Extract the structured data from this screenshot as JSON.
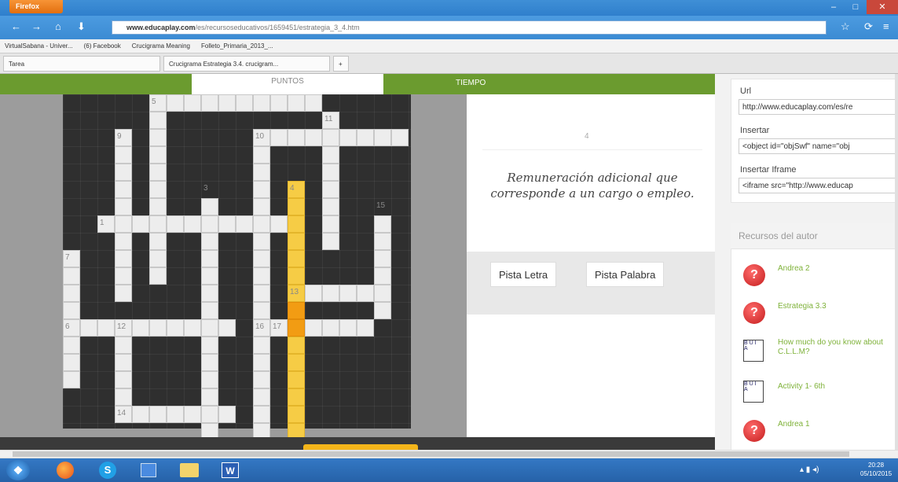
{
  "browser": {
    "app_button": "Firefox",
    "url_domain": "www.educaplay.com",
    "url_rest": "/es/recursoseducativos/1659451/estrategia_3_4.htm",
    "bookmarks": [
      "VirtualSabana - Univer...",
      "(6) Facebook",
      "Crucigrama Meaning",
      "Folleto_Primaria_2013_..."
    ],
    "tabs": [
      "Tarea",
      "Crucigrama Estrategia 3.4. crucigram...",
      "+"
    ]
  },
  "game": {
    "puntos_label": "PUNTOS",
    "tiempo_label": "TIEMPO",
    "clue_number": "4",
    "clue_text": "Remuneración adicional que corresponde a un cargo o empleo.",
    "hint_letter": "Pista Letra",
    "hint_word": "Pista Palabra",
    "numbers": [
      "5",
      "11",
      "9",
      "10",
      "3",
      "4",
      "15",
      "1",
      "7",
      "13",
      "6",
      "12",
      "16",
      "17",
      "14"
    ]
  },
  "sidebar": {
    "url_label": "Url",
    "url_value": "http://www.educaplay.com/es/re",
    "embed_label": "Insertar",
    "embed_value": "<object id=\"objSwf\" name=\"obj",
    "iframe_label": "Insertar Iframe",
    "iframe_value": "<iframe src=\"http://www.educap",
    "resources_title": "Recursos del autor",
    "resources": [
      {
        "title": "Andrea 2",
        "icon": "question-icon"
      },
      {
        "title": "Estrategia 3.3",
        "icon": "question-icon"
      },
      {
        "title": "How much do you know about C.L.L.M?",
        "icon": "text-format-icon"
      },
      {
        "title": "Activity 1- 6th",
        "icon": "text-format-icon"
      },
      {
        "title": "Andrea 1",
        "icon": "question-icon"
      }
    ]
  },
  "taskbar": {
    "time": "20:28",
    "date": "05/10/2015"
  }
}
